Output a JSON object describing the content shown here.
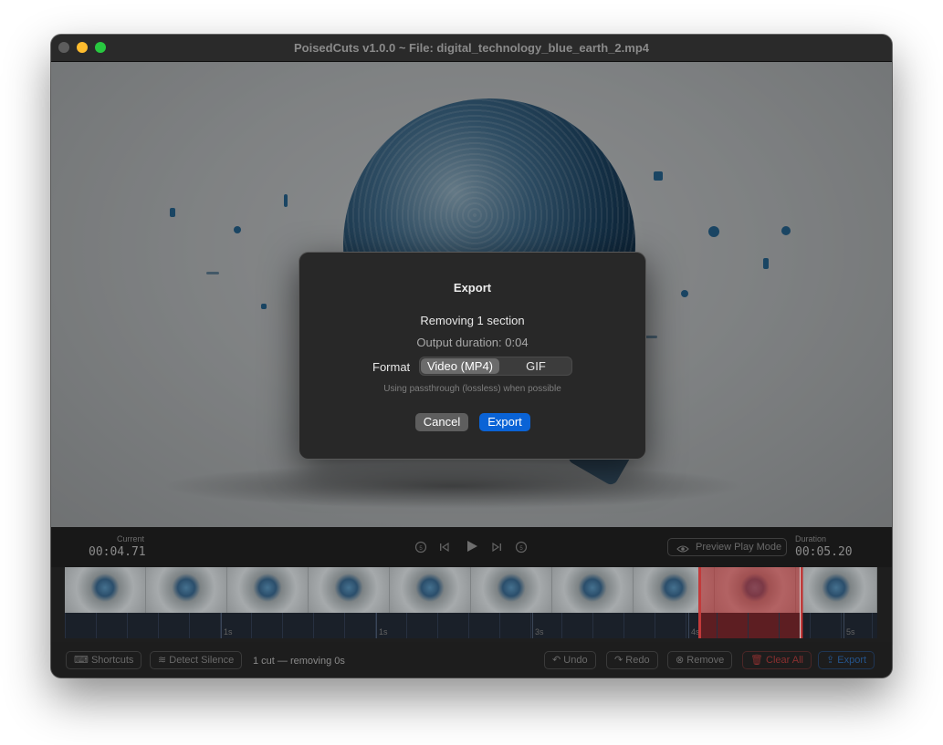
{
  "window": {
    "title": "PoisedCuts v1.0.0 ~ File: digital_technology_blue_earth_2.mp4"
  },
  "dialog": {
    "title": "Export",
    "removing": "Removing 1 section",
    "output_duration": "Output duration: 0:04",
    "format_label": "Format",
    "format_options": [
      "Video (MP4)",
      "GIF"
    ],
    "selected_format": "Video (MP4)",
    "hint": "Using passthrough (lossless) when possible",
    "cancel_label": "Cancel",
    "export_label": "Export"
  },
  "transport": {
    "current_label": "Current",
    "current_time": "00:04.71",
    "duration_label": "Duration",
    "duration_time": "00:05.20",
    "preview_mode_label": "Preview Play Mode",
    "icons": [
      "skip-back-5-icon",
      "step-back-icon",
      "play-icon",
      "step-forward-icon",
      "skip-forward-5-icon",
      "eye-icon"
    ]
  },
  "timeline": {
    "frame_count": 10,
    "tick_labels": [
      "1s",
      "1s",
      "3s",
      "4s",
      "5s"
    ]
  },
  "bottom": {
    "shortcuts_label": "Shortcuts",
    "detect_silence_label": "Detect Silence",
    "status": "1 cut — removing 0s",
    "undo_label": "Undo",
    "redo_label": "Redo",
    "remove_label": "Remove",
    "clear_all_label": "Clear All",
    "export_label": "Export"
  },
  "colors": {
    "accent": "#0a63d6",
    "cut_region": "#be2828",
    "traffic_min": "#febc2e",
    "traffic_max": "#28c840"
  }
}
